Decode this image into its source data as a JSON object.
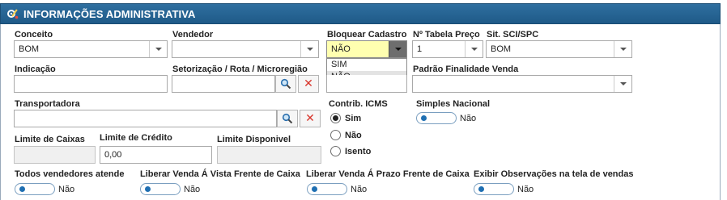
{
  "header": {
    "title": "INFORMAÇÕES ADMINISTRATIVA",
    "icon": "settings-tools-icon"
  },
  "fields": {
    "conceito": {
      "label": "Conceito",
      "value": "BOM"
    },
    "vendedor": {
      "label": "Vendedor",
      "value": ""
    },
    "bloquear_cadastro": {
      "label": "Bloquear Cadastro",
      "value": "NÃO",
      "options": [
        "SIM",
        "NÃO"
      ]
    },
    "tabela_preco": {
      "label": "Nº Tabela Preço",
      "value": "1"
    },
    "sit_sci_spc": {
      "label": "Sit. SCI/SPC",
      "value": "BOM"
    },
    "indicacao": {
      "label": "Indicação",
      "value": ""
    },
    "setorizacao": {
      "label": "Setorização / Rota / Microregião",
      "value": ""
    },
    "padrao_finalidade": {
      "label": "Padrão Finalidade Venda",
      "value": ""
    },
    "transportadora": {
      "label": "Transportadora",
      "value": ""
    },
    "limite_caixas": {
      "label": "Limite de Caixas",
      "value": ""
    },
    "limite_credito": {
      "label": "Limite de Crédito",
      "value": "0,00"
    },
    "limite_disponivel": {
      "label": "Limite Disponivel",
      "value": ""
    }
  },
  "contrib_icms": {
    "label": "Contrib. ICMS",
    "options": [
      "Sim",
      "Não",
      "Isento"
    ],
    "selected": "Sim"
  },
  "toggles": {
    "simples_nacional": {
      "label": "Simples Nacional",
      "state": "Não"
    },
    "todos_vendedores": {
      "label": "Todos vendedores atende",
      "state": "Não"
    },
    "liberar_vista": {
      "label": "Liberar Venda Á Vista Frente de Caixa",
      "state": "Não"
    },
    "liberar_prazo": {
      "label": "Liberar Venda Á Prazo Frente de Caixa",
      "state": "Não"
    },
    "exibir_obs": {
      "label": "Exibir Observações na tela de vendas",
      "state": "Não"
    }
  },
  "colors": {
    "header_bg": "#2a6698",
    "toggle_knob": "#1f6fb2",
    "highlight": "#ffffb0",
    "clear_red": "#d8342a"
  }
}
